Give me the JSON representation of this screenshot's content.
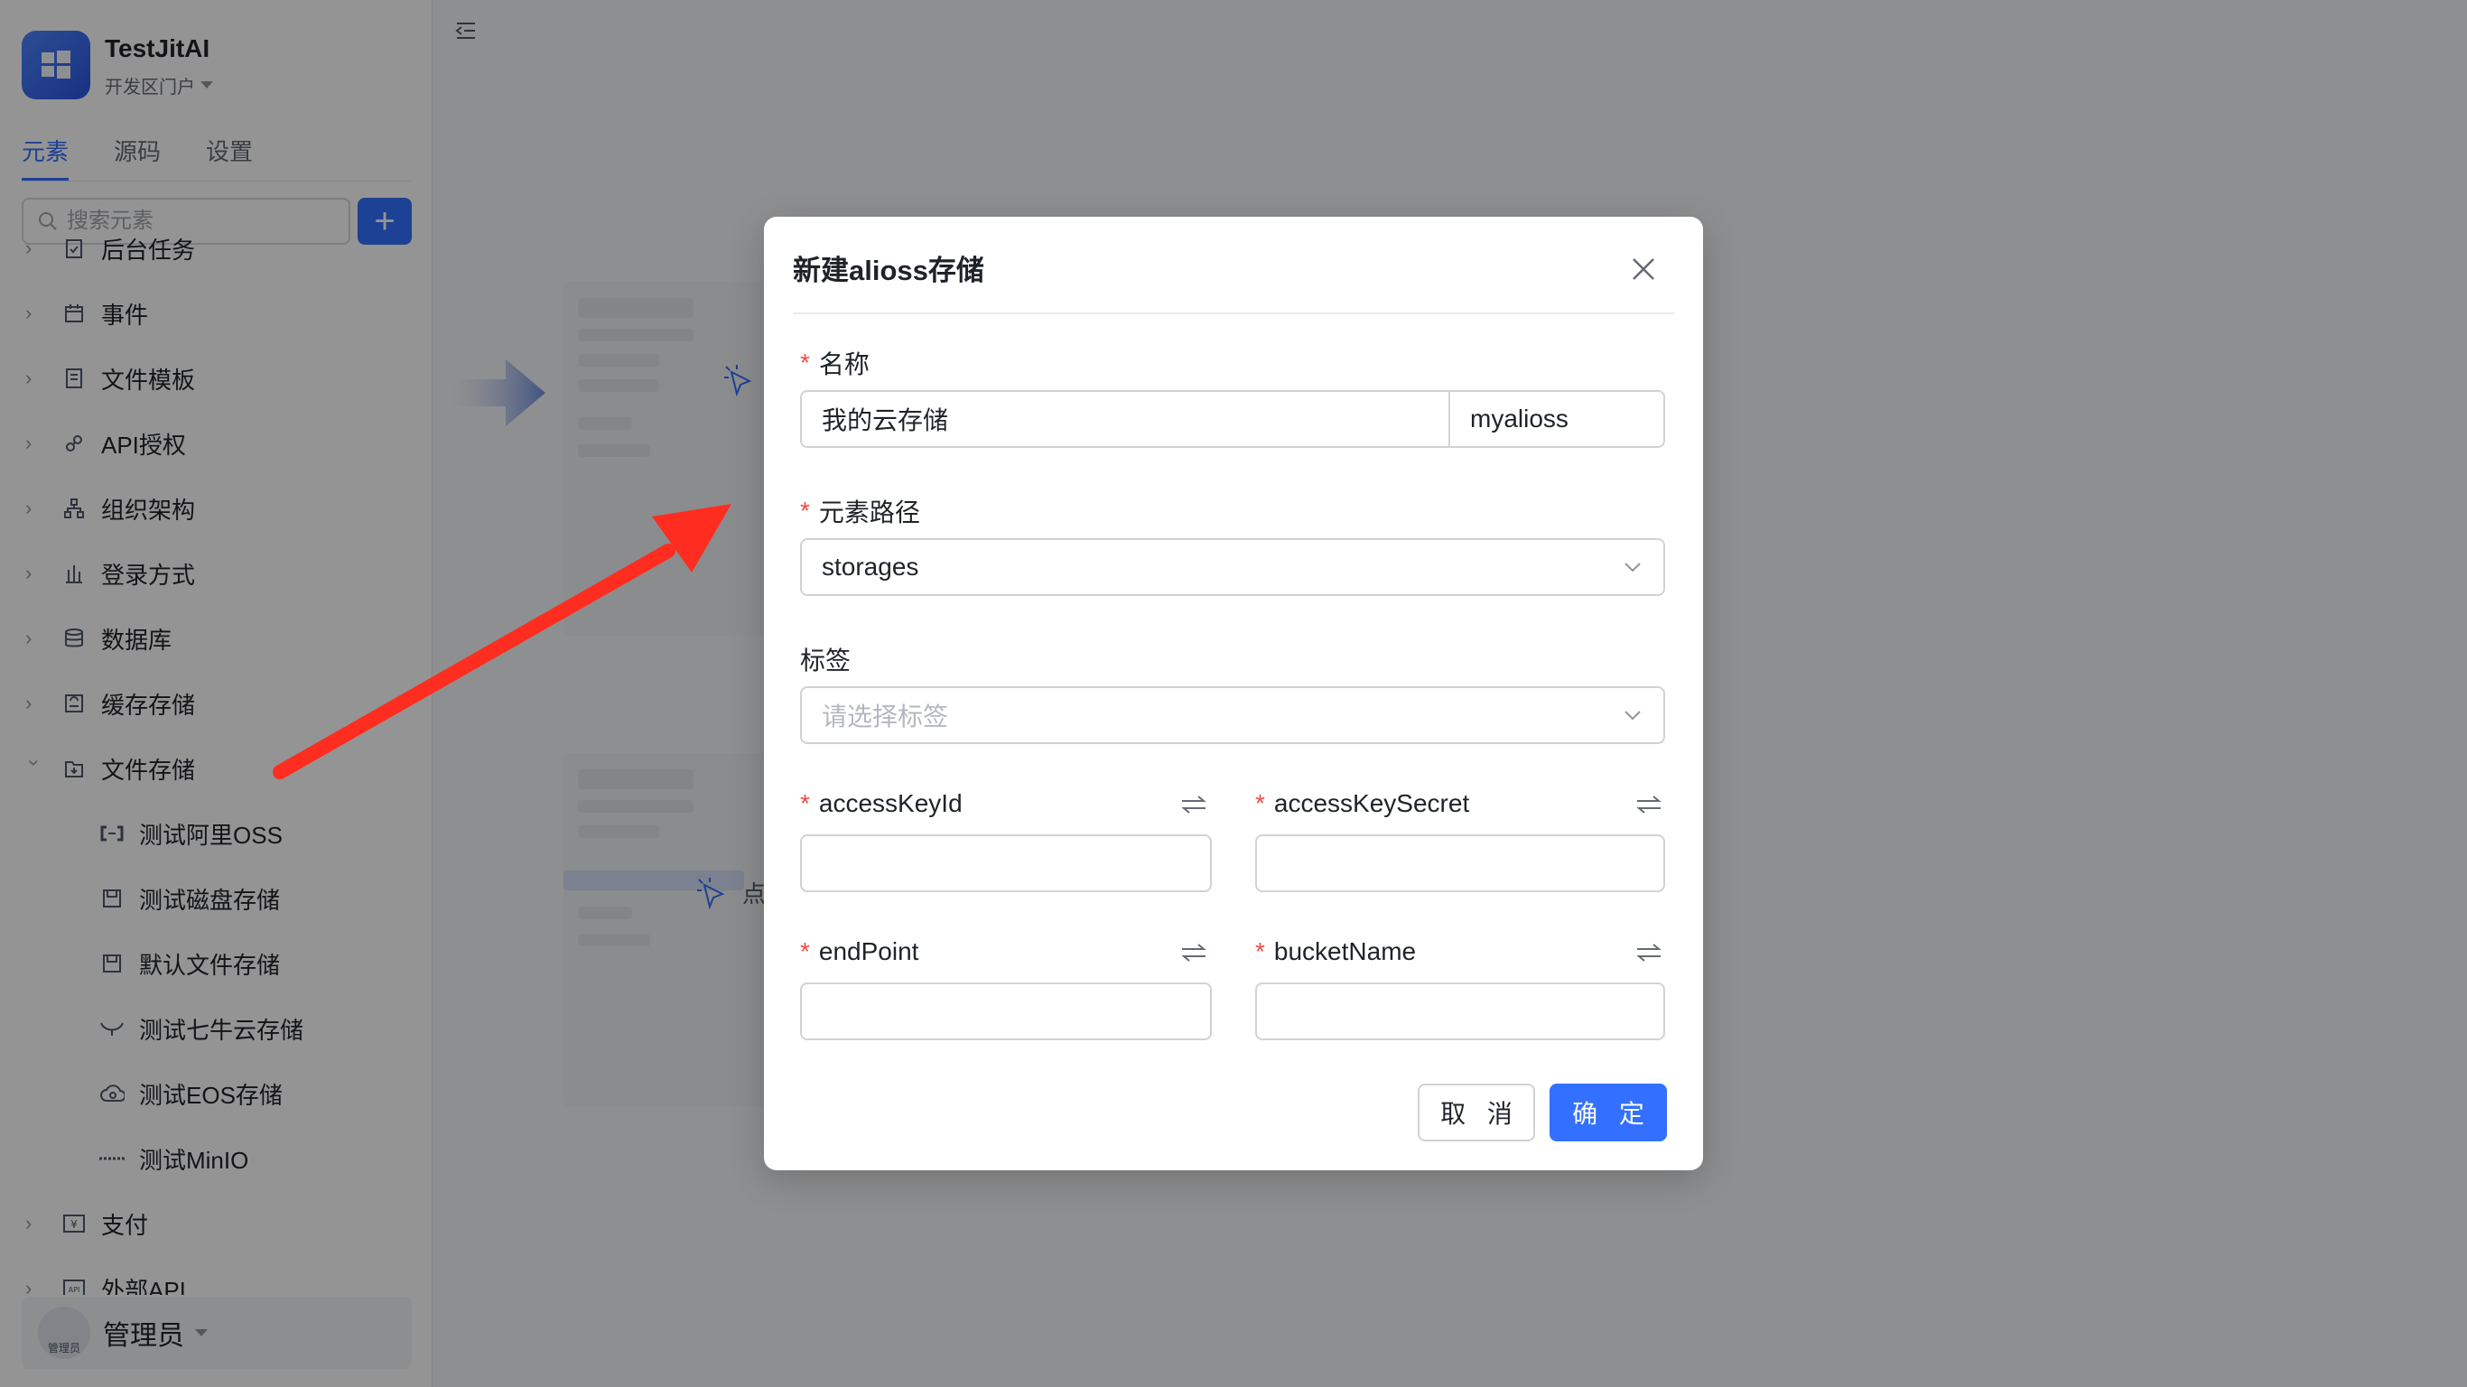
{
  "app": {
    "name": "TestJitAI",
    "portal": "开发区门户"
  },
  "tabs": [
    {
      "label": "元素",
      "active": true
    },
    {
      "label": "源码",
      "active": false
    },
    {
      "label": "设置",
      "active": false
    }
  ],
  "search": {
    "placeholder": "搜索元素",
    "add_label": "+"
  },
  "tree": [
    {
      "label": "后台任务",
      "icon": "task-icon",
      "expanded": false
    },
    {
      "label": "事件",
      "icon": "event-icon",
      "expanded": false
    },
    {
      "label": "文件模板",
      "icon": "file-template-icon",
      "expanded": false
    },
    {
      "label": "API授权",
      "icon": "link-icon",
      "expanded": false
    },
    {
      "label": "组织架构",
      "icon": "org-icon",
      "expanded": false
    },
    {
      "label": "登录方式",
      "icon": "login-icon",
      "expanded": false
    },
    {
      "label": "数据库",
      "icon": "database-icon",
      "expanded": false
    },
    {
      "label": "缓存存储",
      "icon": "cache-icon",
      "expanded": false
    },
    {
      "label": "文件存储",
      "icon": "file-storage-icon",
      "expanded": true
    }
  ],
  "tree_children": [
    {
      "label": "测试阿里OSS",
      "icon": "alioss-icon"
    },
    {
      "label": "测试磁盘存储",
      "icon": "disk-icon"
    },
    {
      "label": "默认文件存储",
      "icon": "disk-icon"
    },
    {
      "label": "测试七牛云存储",
      "icon": "qiniu-icon"
    },
    {
      "label": "测试EOS存储",
      "icon": "eos-icon"
    },
    {
      "label": "测试MinIO",
      "icon": "minio-icon"
    }
  ],
  "tree_after": [
    {
      "label": "支付",
      "icon": "payment-icon"
    },
    {
      "label": "外部API",
      "icon": "api-icon"
    }
  ],
  "user": {
    "name": "管理员",
    "avatar_text": "管理员"
  },
  "modal": {
    "title": "新建alioss存储",
    "name_label": "名称",
    "name_value": "我的云存储",
    "name_id_value": "myalioss",
    "path_label": "元素路径",
    "path_value": "storages",
    "tag_label": "标签",
    "tag_placeholder": "请选择标签",
    "access_key_id_label": "accessKeyId",
    "access_key_secret_label": "accessKeySecret",
    "endpoint_label": "endPoint",
    "bucket_name_label": "bucketName",
    "required_mark": "*",
    "cancel_label": "取 消",
    "ok_label": "确 定"
  },
  "background_hint": "点",
  "colors": {
    "primary": "#3370ff",
    "required": "#f54a45",
    "arrow": "#ff2d20"
  }
}
